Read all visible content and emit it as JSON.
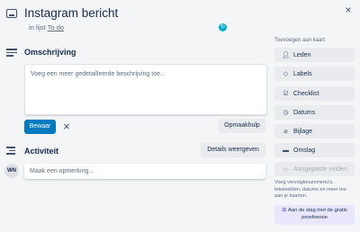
{
  "header": {
    "title": "Instagram bericht",
    "subtitle_prefix": "in lijst",
    "list_name": "To do",
    "close_glyph": "×"
  },
  "description": {
    "title": "Omschrijving",
    "placeholder": "Voeg een meer gedetailleerde beschrijving toe...",
    "save_label": "Bewaar",
    "cancel_glyph": "×",
    "format_label": "Opmaakhulp"
  },
  "activity": {
    "title": "Activiteit",
    "details_label": "Details weergeven",
    "avatar_initials": "WN",
    "comment_placeholder": "Maak een opmerking..."
  },
  "sidebar": {
    "heading": "Toevoegen aan kaart",
    "items": [
      {
        "label": "Leden",
        "icon": "user-icon"
      },
      {
        "label": "Labels",
        "icon": "tag-icon"
      },
      {
        "label": "Checklist",
        "icon": "checklist-icon"
      },
      {
        "label": "Datums",
        "icon": "clock-icon"
      },
      {
        "label": "Bijlage",
        "icon": "paperclip-icon"
      },
      {
        "label": "Omslag",
        "icon": "cover-icon"
      },
      {
        "label": "Aangepaste velden",
        "icon": "custom-fields-icon"
      }
    ],
    "note": "Voeg vervolgkeuzemenu's, tekstvelden, datums en meer toe aan je kaarten.",
    "promo": "Aan de slag met de gratis proefversie"
  },
  "colors": {
    "primary": "#0079bf",
    "background": "#f4f5f7",
    "button_gray": "#e9ebee",
    "promo_bg": "#eae6ff"
  }
}
